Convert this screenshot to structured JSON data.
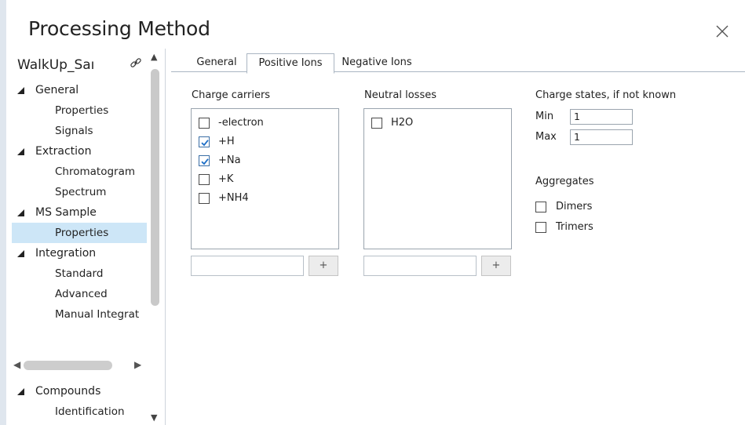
{
  "dialog": {
    "title": "Processing Method"
  },
  "nav": {
    "header": "WalkUp_Saı",
    "tree": [
      {
        "type": "node",
        "label": "General"
      },
      {
        "type": "leaf",
        "label": "Properties",
        "selected": false
      },
      {
        "type": "leaf",
        "label": "Signals",
        "selected": false
      },
      {
        "type": "node",
        "label": "Extraction"
      },
      {
        "type": "leaf",
        "label": "Chromatogram",
        "selected": false
      },
      {
        "type": "leaf",
        "label": "Spectrum",
        "selected": false
      },
      {
        "type": "node",
        "label": "MS Sample"
      },
      {
        "type": "leaf",
        "label": "Properties",
        "selected": true
      },
      {
        "type": "node",
        "label": "Integration"
      },
      {
        "type": "leaf",
        "label": "Standard",
        "selected": false
      },
      {
        "type": "leaf",
        "label": "Advanced",
        "selected": false
      },
      {
        "type": "leaf",
        "label": "Manual Integrat",
        "selected": false
      }
    ],
    "tree_bottom": [
      {
        "type": "node",
        "label": "Compounds"
      },
      {
        "type": "leaf",
        "label": "Identification",
        "selected": false
      }
    ]
  },
  "tabs": [
    {
      "label": "General",
      "active": false
    },
    {
      "label": "Positive Ions",
      "active": true
    },
    {
      "label": "Negative Ions",
      "active": false
    }
  ],
  "charge_carriers": {
    "label": "Charge carriers",
    "items": [
      {
        "label": "-electron",
        "checked": false
      },
      {
        "label": "+H",
        "checked": true
      },
      {
        "label": "+Na",
        "checked": true
      },
      {
        "label": "+K",
        "checked": false
      },
      {
        "label": "+NH4",
        "checked": false
      }
    ],
    "input_value": "",
    "add_label": "+"
  },
  "neutral_losses": {
    "label": "Neutral losses",
    "items": [
      {
        "label": "H2O",
        "checked": false
      }
    ],
    "input_value": "",
    "add_label": "+"
  },
  "charge_states": {
    "label": "Charge states, if not known",
    "min_label": "Min",
    "min_value": "1",
    "max_label": "Max",
    "max_value": "1"
  },
  "aggregates": {
    "label": "Aggregates",
    "items": [
      {
        "label": "Dimers",
        "checked": false
      },
      {
        "label": "Trimers",
        "checked": false
      }
    ]
  },
  "colors": {
    "accent_check": "#1e6fc7",
    "selection": "#cde6f7"
  },
  "icons": {
    "close": "close-icon",
    "link": "link-icon"
  }
}
